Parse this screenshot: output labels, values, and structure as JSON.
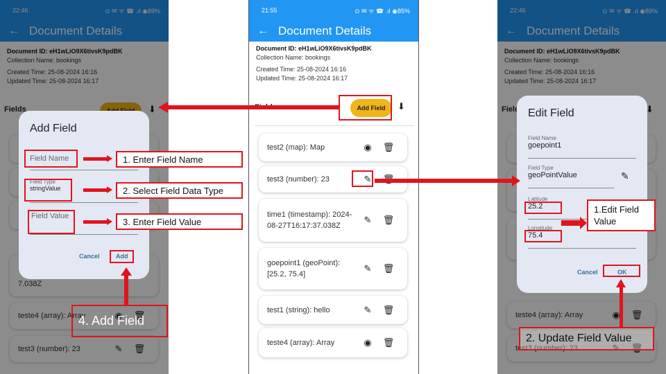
{
  "doc": {
    "id_label": "Document ID: eH1wLiO9X6tivsK9pdBK",
    "collection": "Collection Name: bookings",
    "created": "Created Time: 25-08-2024 16:16",
    "updated": "Updated Time: 25-08-2024 16:17",
    "fields_label": "Fields",
    "add_field": "Add Field"
  },
  "appbar": {
    "title": "Document Details",
    "back": "←",
    "download": "⬇"
  },
  "phone_left": {
    "time": "22:46",
    "status": "⊙ ✉ ᯤ ☎ .ıl ◉89%"
  },
  "phone_mid": {
    "time": "21:55",
    "status": "⊙ ✉ ᯤ ☎ .ıl ◉85%"
  },
  "phone_right": {
    "time": "22:46",
    "status": "⊙ ✉ ᯤ ☎ .ıl ◉89%"
  },
  "fields": [
    {
      "text": "test2 (map): Map",
      "icon": "eye"
    },
    {
      "text": "test3 (number): 23",
      "icon": "pencil"
    },
    {
      "text": "time1 (timestamp): 2024-08-27T16:17:37.038Z",
      "icon": "pencil"
    },
    {
      "text": "goepoint1 (geoPoint): [25.2, 75.4]",
      "icon": "pencil"
    },
    {
      "text": "test1 (string): hello",
      "icon": "pencil"
    },
    {
      "text": "teste4 (array): Array",
      "icon": "eye"
    }
  ],
  "left_bg": {
    "partial": "7.038Z",
    "item1": "teste4 (array): Array",
    "item2": "test3 (number): 23"
  },
  "add_dialog": {
    "title": "Add Field",
    "field_name": "Field Name",
    "field_type_label": "Field Type",
    "field_type_value": "stringValue",
    "field_value": "Field Value",
    "cancel": "Cancel",
    "add": "Add"
  },
  "edit_dialog": {
    "title": "Edit Field",
    "name_label": "Field Name",
    "name_value": "goepoint1",
    "type_label": "Field Type",
    "type_value": "geoPointValue",
    "lat_label": "Latitude",
    "lat_value": "25.2",
    "lng_label": "Longitude",
    "lng_value": "75.4",
    "cancel": "Cancel",
    "ok": "OK"
  },
  "right_bg": {
    "item1": "teste4 (array): Array",
    "item2": "test3 (number): 23"
  },
  "annotations": {
    "step1": "1. Enter  Field  Name",
    "step2": "2. Select Field Data Type",
    "step3": "3. Enter Field Value",
    "step4": "4. Add Field",
    "edit1": "1.Edit Field Value",
    "edit2": "2. Update Field Value"
  },
  "colors": {
    "appbar": "#2196f3",
    "accent": "#f0b51a",
    "annotation": "#e0141c"
  }
}
